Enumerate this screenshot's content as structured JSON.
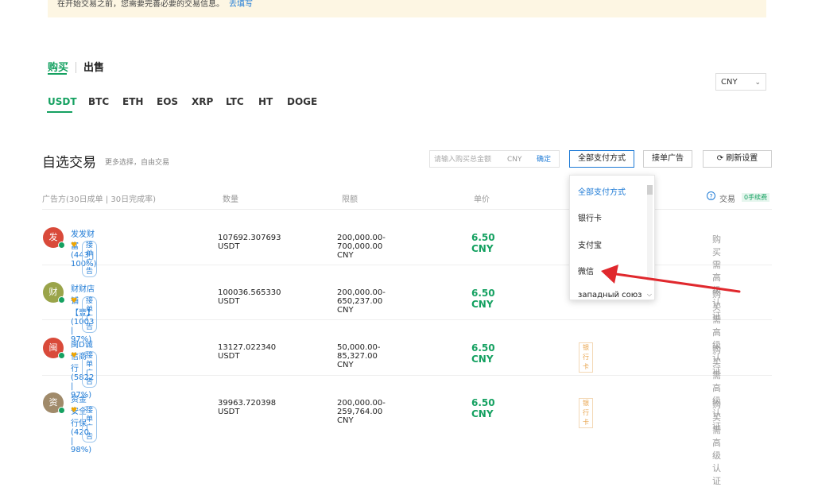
{
  "banner": {
    "text": "在开始交易之前，您需要完善必要的交易信息。",
    "link": "去填写"
  },
  "side_tabs": [
    "购买",
    "出售"
  ],
  "currency_select": {
    "value": "CNY",
    "chevron": "chevron-down-icon"
  },
  "coin_tabs": [
    "USDT",
    "BTC",
    "ETH",
    "EOS",
    "XRP",
    "LTC",
    "HT",
    "DOGE"
  ],
  "section": {
    "title": "自选交易",
    "subtitle": "更多选择，自由交易"
  },
  "amount_input": {
    "placeholder": "请输入购买总金额",
    "unit": "CNY",
    "confirm": "确定"
  },
  "buttons": {
    "payment_methods": "全部支付方式",
    "fixed_ads": "接单广告",
    "refresh": "刷新设置"
  },
  "columns": {
    "advertiser": "广告方(30日成单 | 30日完成率)",
    "quantity": "数量",
    "limit": "限额",
    "price": "单价"
  },
  "hint": {
    "text": "交易",
    "badge": "0手续费",
    "icon": "question-circle-icon"
  },
  "rows": [
    {
      "avatar_char": "发",
      "avatar_color": "#d94a3a",
      "name": "发发财富 (443 | 100%)",
      "tag": "接单广告",
      "qty": "107692.307693 USDT",
      "limit": "200,000.00-700,000.00 CNY",
      "price": "6.50 CNY",
      "pay": "",
      "action": "购买需高级认证"
    },
    {
      "avatar_char": "财",
      "avatar_color": "#9aa44a",
      "name": "财财店铺【壹】 (1003 | 97%)",
      "tag": "接单广告",
      "qty": "100036.565330 USDT",
      "limit": "200,000.00-650,237.00 CNY",
      "price": "6.50 CNY",
      "pay": "",
      "action": "购买需高级认证"
    },
    {
      "avatar_char": "闽",
      "avatar_color": "#d94a3a",
      "name": "闽D诚信商行 (5822 | 97%)",
      "tag": "接单广告",
      "qty": "13127.022340 USDT",
      "limit": "50,000.00-85,327.00 CNY",
      "price": "6.50 CNY",
      "pay": "银行卡",
      "action": "购买需高级认证"
    },
    {
      "avatar_char": "资",
      "avatar_color": "#a08a6a",
      "name": "资金安全行保 (420 | 98%)",
      "tag": "接单广告",
      "qty": "39963.720398 USDT",
      "limit": "200,000.00-259,764.00 CNY",
      "price": "6.50 CNY",
      "pay": "银行卡",
      "action": "购买需高级认证"
    }
  ],
  "dropdown": {
    "items": [
      "全部支付方式",
      "银行卡",
      "支付宝",
      "微信",
      "западный союз"
    ],
    "active_index": 0
  },
  "colors": {
    "accent": "#15a161",
    "link": "#1f7bd6",
    "annotation": "#e0282d"
  }
}
